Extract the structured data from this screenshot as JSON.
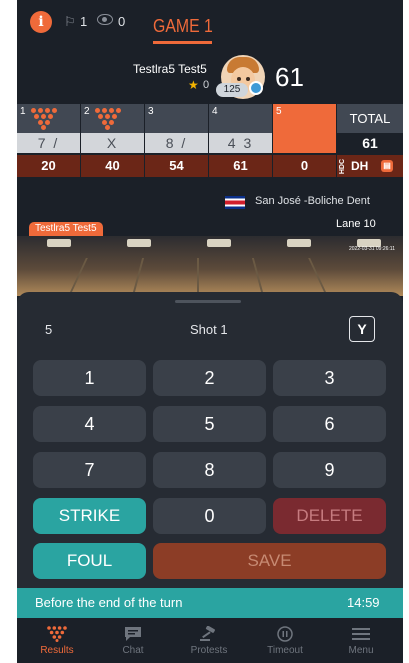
{
  "topbar": {
    "flag_count": "1",
    "eye_count": "0",
    "game_tab": "GAME 1"
  },
  "player": {
    "name": "Testlra5 Test5",
    "stars": "0",
    "handicap": "125",
    "score": "61"
  },
  "frames": [
    {
      "number": "1",
      "marks": "7 /",
      "total": "20"
    },
    {
      "number": "2",
      "marks": "X",
      "total": "40"
    },
    {
      "number": "3",
      "marks": "8 /",
      "total": "54"
    },
    {
      "number": "4",
      "marks": "4 3",
      "total": "61"
    },
    {
      "number": "5",
      "marks": "",
      "total": "0"
    }
  ],
  "total": {
    "header": "TOTAL",
    "score": "61",
    "hdc_label": "HDC",
    "dh_label": "DH"
  },
  "venue": {
    "name": "San José -Boliche Dent",
    "lane": "Lane 10"
  },
  "video": {
    "name_tag": "Testlra5 Test5",
    "timestamp": "2022-03-31 09:26:11"
  },
  "panel": {
    "frame_number": "5",
    "shot_label": "Shot 1",
    "pin_button_glyph": "Y"
  },
  "keypad": {
    "keys": [
      "1",
      "2",
      "3",
      "4",
      "5",
      "6",
      "7",
      "8",
      "9"
    ],
    "strike": "STRIKE",
    "zero": "0",
    "delete": "DELETE",
    "foul": "FOUL",
    "save": "SAVE"
  },
  "timer": {
    "text": "Before the end of the turn",
    "value": "14:59"
  },
  "nav": {
    "results": "Results",
    "chat": "Chat",
    "protests": "Protests",
    "timeout": "Timeout",
    "menu": "Menu"
  },
  "colors": {
    "accent": "#ef6a3a",
    "teal": "#2aa4a1",
    "background": "#1b2028",
    "panel": "#262b33",
    "frame_total": "#6b2617"
  }
}
